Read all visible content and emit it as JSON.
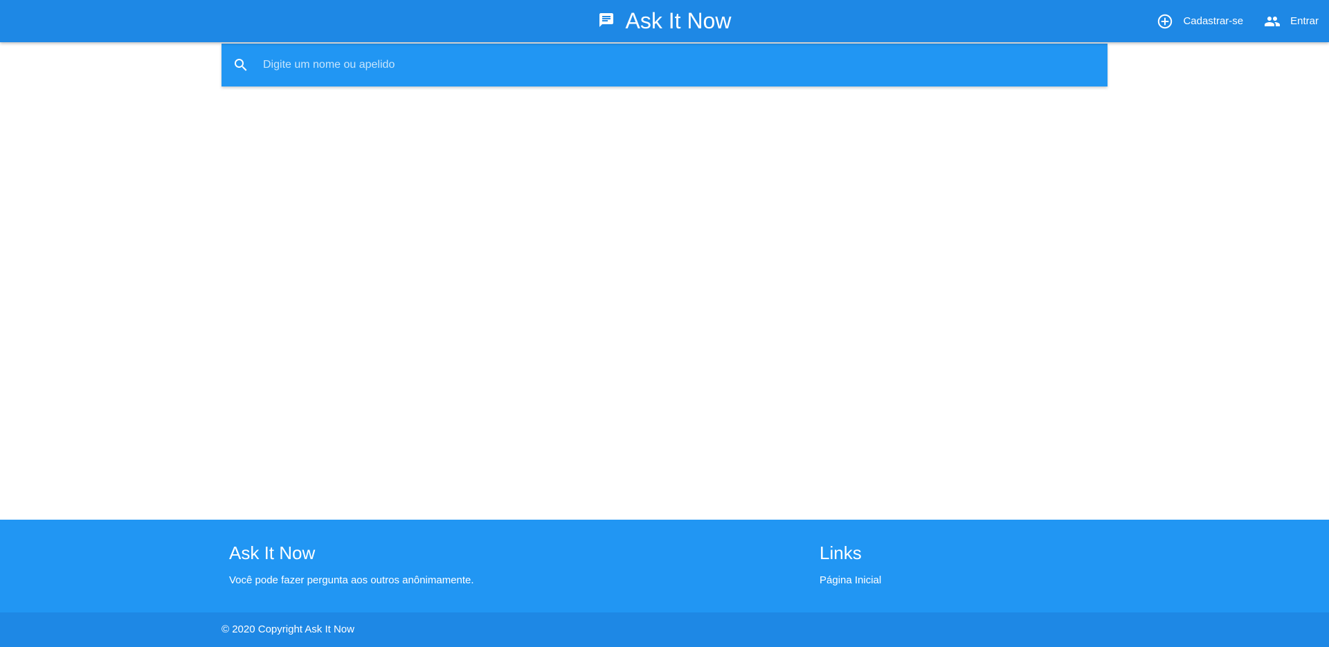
{
  "navbar": {
    "brand_title": "Ask It Now",
    "brand_icon": "chat-message-icon",
    "links": [
      {
        "label": "Cadastrar-se",
        "icon": "add-circle-icon"
      },
      {
        "label": "Entrar",
        "icon": "people-icon"
      }
    ]
  },
  "search": {
    "placeholder": "Digite um nome ou apelido",
    "value": "",
    "icon": "search-icon"
  },
  "footer": {
    "about": {
      "heading": "Ask It Now",
      "text": "Você pode fazer pergunta aos outros anônimamente."
    },
    "links": {
      "heading": "Links",
      "items": [
        "Página Inicial"
      ]
    },
    "copyright": "© 2020 Copyright Ask It Now"
  },
  "colors": {
    "navbar": "#1e88e5",
    "search_bar": "#2196f3",
    "footer": "#2196f3",
    "footer_copyright": "#1e88e5",
    "text": "#ffffff"
  }
}
